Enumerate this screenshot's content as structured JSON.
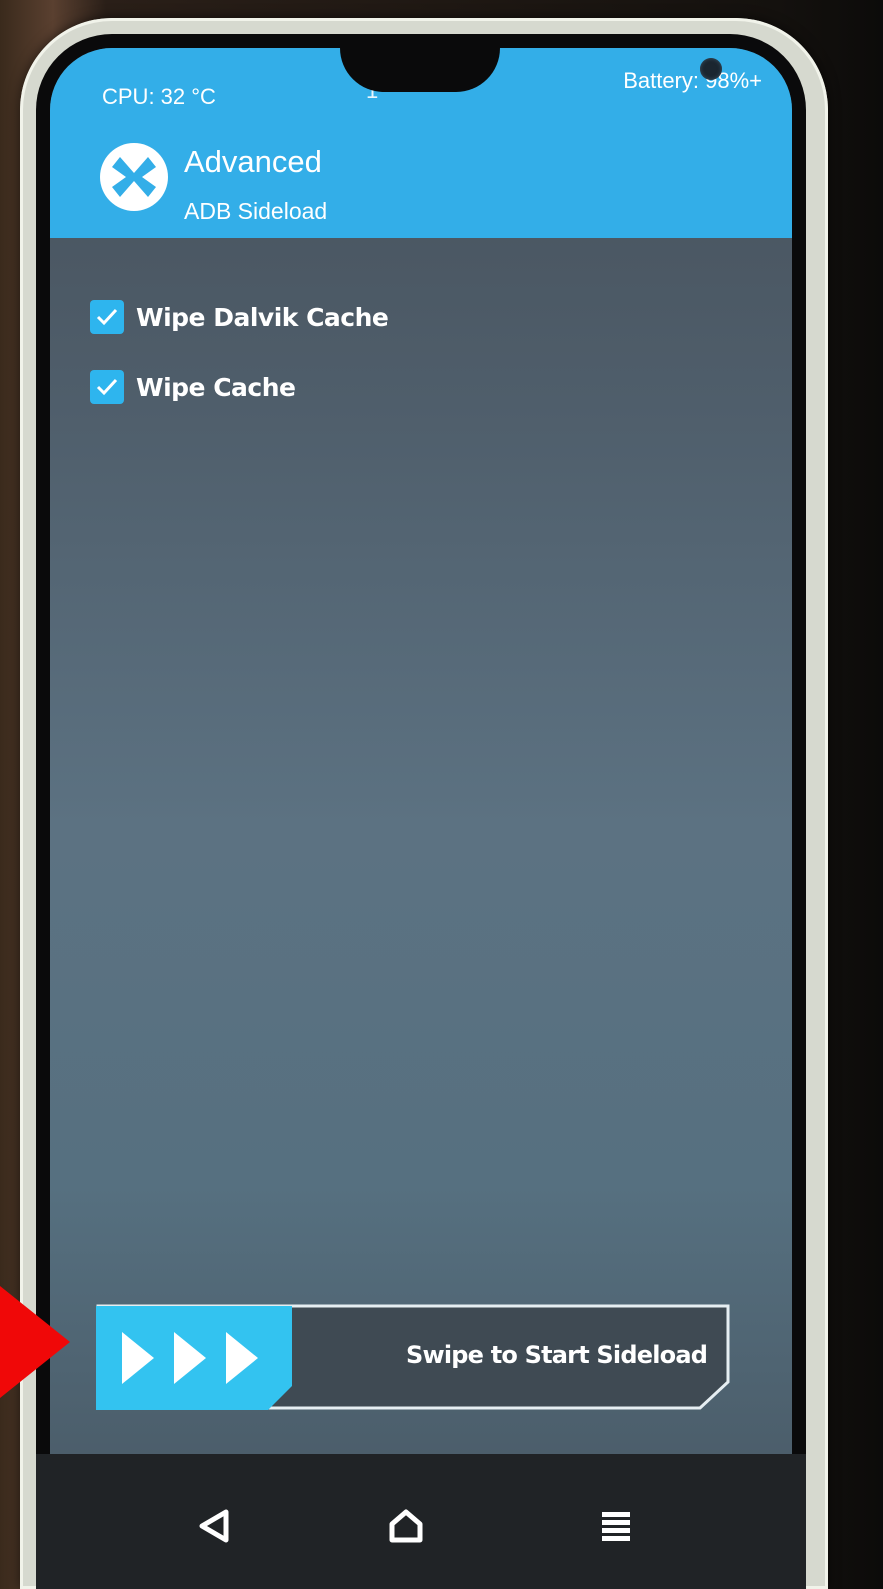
{
  "status_bar": {
    "cpu": "CPU: 32 °C",
    "time": "1",
    "battery": "Battery: 98%+"
  },
  "header": {
    "title": "Advanced",
    "subtitle": "ADB Sideload"
  },
  "options": [
    {
      "label": "Wipe Dalvik Cache",
      "checked": true
    },
    {
      "label": "Wipe Cache",
      "checked": true
    }
  ],
  "slider": {
    "label": "Swipe to Start Sideload"
  },
  "navigation": {
    "back": "back-icon",
    "home": "home-icon",
    "menu": "menu-icon"
  },
  "colors": {
    "accent": "#33aee8",
    "screen_bg": "#4f5e6b",
    "handle": "#33c3f0",
    "arrow": "#f00808"
  }
}
